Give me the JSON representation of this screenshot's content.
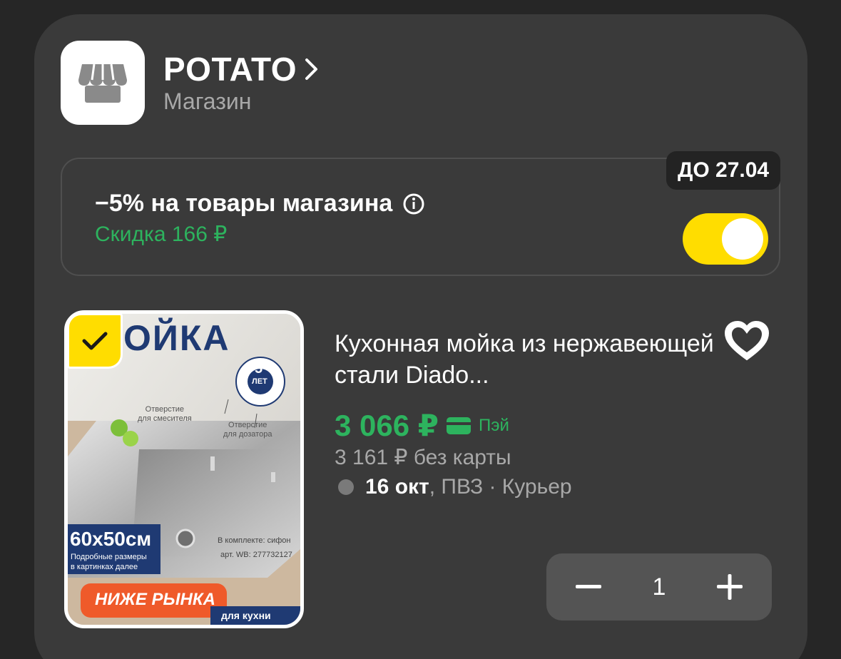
{
  "store": {
    "name": "POTATO",
    "type": "Магазин"
  },
  "promo": {
    "title": "−5% на товары магазина",
    "discount": "Скидка 166 ₽",
    "deadline": "ДО 27.04",
    "enabled": true
  },
  "product": {
    "title": "Кухонная мойка из нержавеющей стали Diado...",
    "price": "3 066 ₽",
    "pay_label": "Пэй",
    "price_no_card": "3 161 ₽  без карты",
    "delivery_date": "16 окт",
    "delivery_methods": ", ПВЗ · Курьер",
    "selected": true,
    "quantity": "1",
    "image": {
      "headline": "ОЙКА",
      "warranty_top": "5",
      "warranty_bottom": "ЛЕТ",
      "hole_mixer": "Отверстие\nдля смесителя",
      "hole_dispenser": "Отверстие\nдля дозатора",
      "size": "60x50см",
      "size_note": "Подробные размеры\nв картинках далее",
      "kit": "В комплекте: сифон",
      "article": "арт. WB: 277732127",
      "badge": "НИЖЕ РЫНКА",
      "footer": "для кухни"
    }
  },
  "colors": {
    "accent_yellow": "#ffdd00",
    "green": "#2db35e",
    "card_bg": "#3a3a3a",
    "page_bg": "#262626"
  },
  "icons": {
    "store": "store-awning-icon",
    "chevron": "chevron-right-icon",
    "info": "info-icon",
    "favorite": "heart-icon",
    "check": "checkmark-icon",
    "pay": "card-icon",
    "minus": "minus-icon",
    "plus": "plus-icon"
  }
}
